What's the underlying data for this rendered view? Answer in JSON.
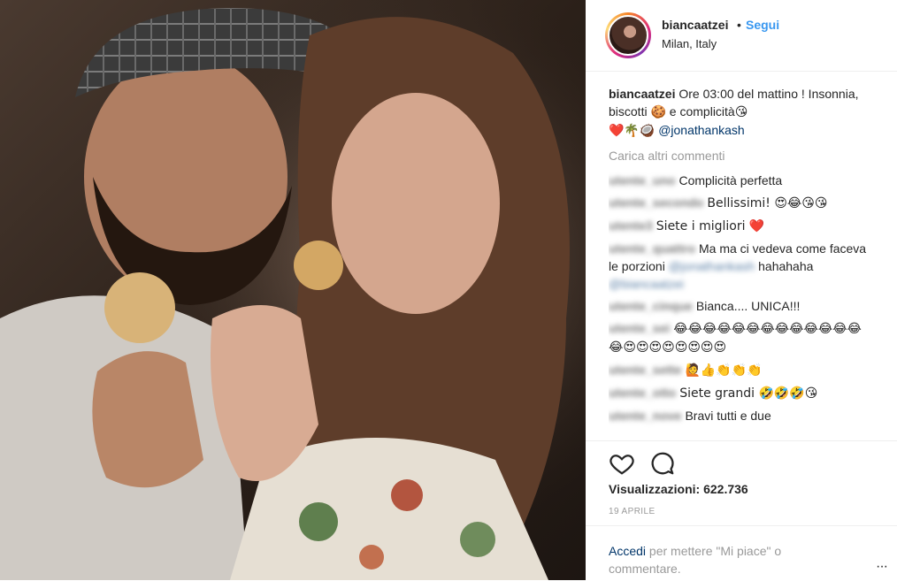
{
  "header": {
    "username": "biancaatzei",
    "separator": "•",
    "follow_label": "Segui",
    "location": "Milan, Italy"
  },
  "caption": {
    "username": "biancaatzei",
    "text_1": "Ore 03:00 del mattino ! Insonnia, biscotti ",
    "emoji_cookie": "🍪",
    "text_2": " e complicità",
    "emoji_kiss": "😘",
    "emoji_line": "❤️🌴🥥",
    "mention": "@jonathankash"
  },
  "load_more_label": "Carica altri commenti",
  "comments": [
    {
      "user": "utente_uno",
      "text": "Complicità perfetta"
    },
    {
      "user": "utente_secondo",
      "text": "Bellissimi! 😍😂😘😘"
    },
    {
      "user": "utente3",
      "text": "Siete i migliori ❤️"
    },
    {
      "user": "utente_quattro",
      "text": "Ma ma ci vedeva come faceva le porzioni",
      "mention_1": "@jonathankash",
      "text_2": "hahahaha",
      "mention_2": "@biancaatzei"
    },
    {
      "user": "utente_cinque",
      "text": "Bianca.... UNICA!!!"
    },
    {
      "user": "utente_sei",
      "text": "😂😂😂😂😂😂😂😂😂😂😂😂😂😂😍😍😍😍😍😍😍😍"
    },
    {
      "user": "utente_sette",
      "text": "🙋👍👏👏👏"
    },
    {
      "user": "utente_otto",
      "text": "Siete grandi 🤣🤣🤣😘"
    },
    {
      "user": "utente_nove",
      "text": "Bravi tutti e due"
    }
  ],
  "actions": {
    "like_icon": "heart-outline-icon",
    "comment_icon": "speech-bubble-icon",
    "views_label": "Visualizzazioni: 622.736",
    "date": "19 APRILE"
  },
  "login_prompt": {
    "link": "Accedi",
    "rest": " per mettere \"Mi piace\" o commentare."
  },
  "more_options": "···",
  "colors": {
    "accent_blue": "#3897f0",
    "mention_blue": "#003569",
    "muted_gray": "#999999",
    "text": "#262626"
  }
}
